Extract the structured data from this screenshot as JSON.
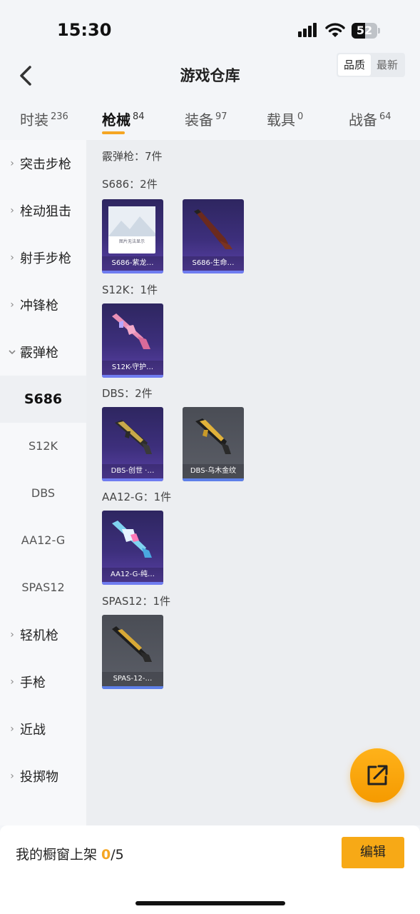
{
  "status_bar": {
    "time": "15:30",
    "battery": "52",
    "battery_level": 0.52
  },
  "header": {
    "title": "游戏仓库"
  },
  "sort": {
    "quality": "品质",
    "latest": "最新"
  },
  "tabs": [
    {
      "label": "时装",
      "count": "236"
    },
    {
      "label": "枪械",
      "count": "84"
    },
    {
      "label": "装备",
      "count": "97"
    },
    {
      "label": "载具",
      "count": "0"
    },
    {
      "label": "战备",
      "count": "64"
    }
  ],
  "sidebar": {
    "categories": [
      {
        "label": "突击步枪"
      },
      {
        "label": "栓动狙击"
      },
      {
        "label": "射手步枪"
      },
      {
        "label": "冲锋枪"
      },
      {
        "label": "霰弹枪"
      },
      {
        "label": "轻机枪"
      },
      {
        "label": "手枪"
      },
      {
        "label": "近战"
      },
      {
        "label": "投掷物"
      }
    ],
    "subitems": [
      {
        "label": "S686"
      },
      {
        "label": "S12K"
      },
      {
        "label": "DBS"
      },
      {
        "label": "AA12-G"
      },
      {
        "label": "SPAS12"
      }
    ]
  },
  "main": {
    "section_title": "霰弹枪：7件",
    "groups": [
      {
        "title": "S686：2件",
        "items": [
          {
            "name": "S686-紫龙…",
            "placeholder_text": "图片无法显示"
          },
          {
            "name": "S686-生命…"
          }
        ]
      },
      {
        "title": "S12K：1件",
        "items": [
          {
            "name": "S12K-守护…"
          }
        ]
      },
      {
        "title": "DBS：2件",
        "items": [
          {
            "name": "DBS-创世 ·…"
          },
          {
            "name": "DBS-乌木金纹"
          }
        ]
      },
      {
        "title": "AA12-G：1件",
        "items": [
          {
            "name": "AA12-G-纯…"
          }
        ]
      },
      {
        "title": "SPAS12：1件",
        "items": [
          {
            "name": "SPAS-12-…"
          }
        ]
      }
    ]
  },
  "bottom": {
    "showcase_label": "我的橱窗上架 ",
    "showcase_count": "0",
    "showcase_total": "/5",
    "edit_label": "编辑"
  }
}
